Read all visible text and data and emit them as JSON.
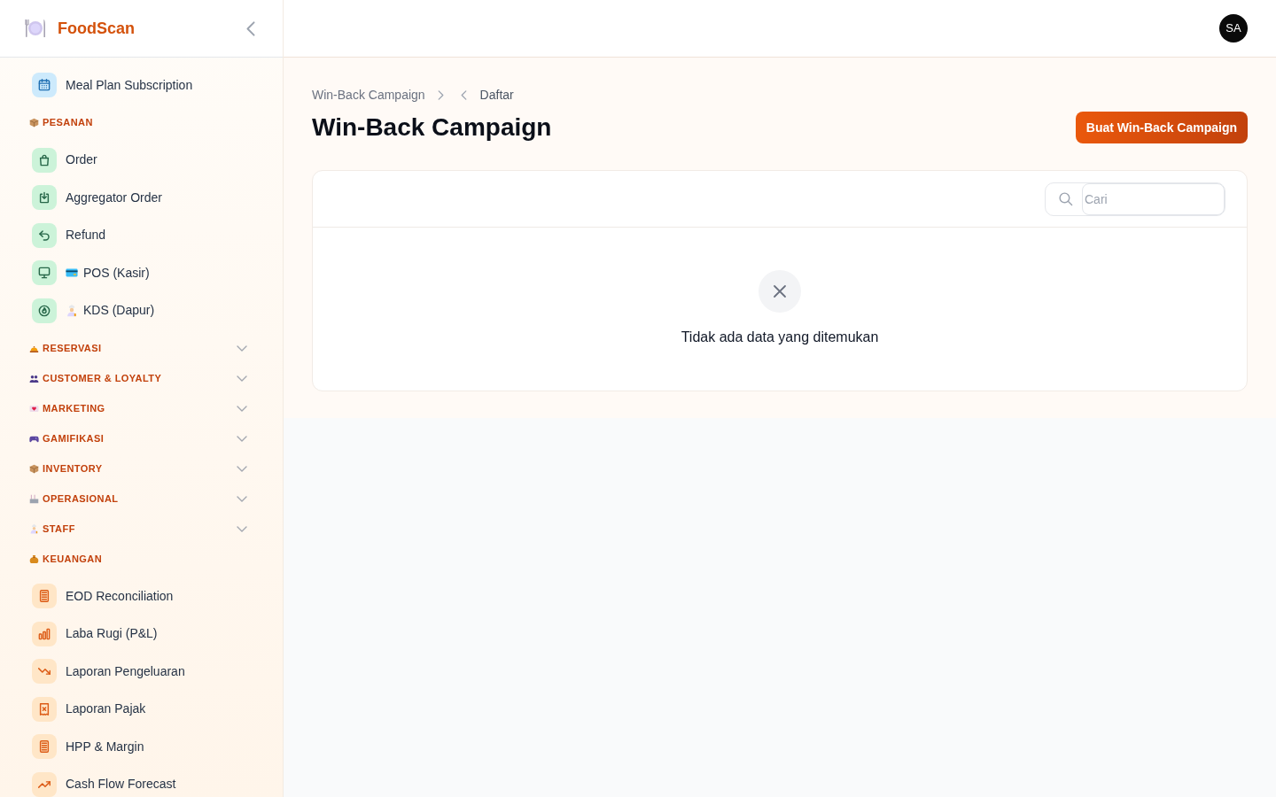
{
  "app": {
    "name": "FoodScan"
  },
  "header": {
    "user_initials": "SA"
  },
  "sidebar": {
    "sections": [
      {
        "items": [
          {
            "label": "Meal Plan Subscription",
            "selected": false
          }
        ]
      },
      {
        "title": "PESANAN",
        "expanded": true,
        "items": [
          {
            "label": "Order",
            "selected": false
          },
          {
            "label": "Aggregator Order",
            "selected": false
          },
          {
            "label": "Refund",
            "selected": false
          },
          {
            "label": "POS (Kasir)",
            "selected": false
          },
          {
            "label": "KDS (Dapur)",
            "selected": false
          }
        ]
      },
      {
        "title": "RESERVASI",
        "expanded": false
      },
      {
        "title": "CUSTOMER & LOYALTY",
        "expanded": false
      },
      {
        "title": "MARKETING",
        "expanded": false
      },
      {
        "title": "GAMIFIKASI",
        "expanded": false
      },
      {
        "title": "INVENTORY",
        "expanded": false
      },
      {
        "title": "OPERASIONAL",
        "expanded": false
      },
      {
        "title": "STAFF",
        "expanded": false
      },
      {
        "title": "KEUANGAN",
        "expanded": true,
        "items": [
          {
            "label": "EOD Reconciliation",
            "selected": false
          },
          {
            "label": "Laba Rugi (P&L)",
            "selected": false
          },
          {
            "label": "Laporan Pengeluaran",
            "selected": false
          },
          {
            "label": "Laporan Pajak",
            "selected": false
          },
          {
            "label": "HPP & Margin",
            "selected": false
          },
          {
            "label": "Cash Flow Forecast",
            "selected": false
          }
        ]
      }
    ]
  },
  "breadcrumb": [
    {
      "label": "Win-Back Campaign",
      "kind": "link"
    },
    {
      "label": "Daftar",
      "kind": "back"
    }
  ],
  "page": {
    "title": "Win-Back Campaign",
    "primary_button": "Buat Win-Back Campaign"
  },
  "table": {
    "search": {
      "placeholder": "Cari"
    },
    "empty_message": "Tidak ada data yang ditemukan"
  }
}
